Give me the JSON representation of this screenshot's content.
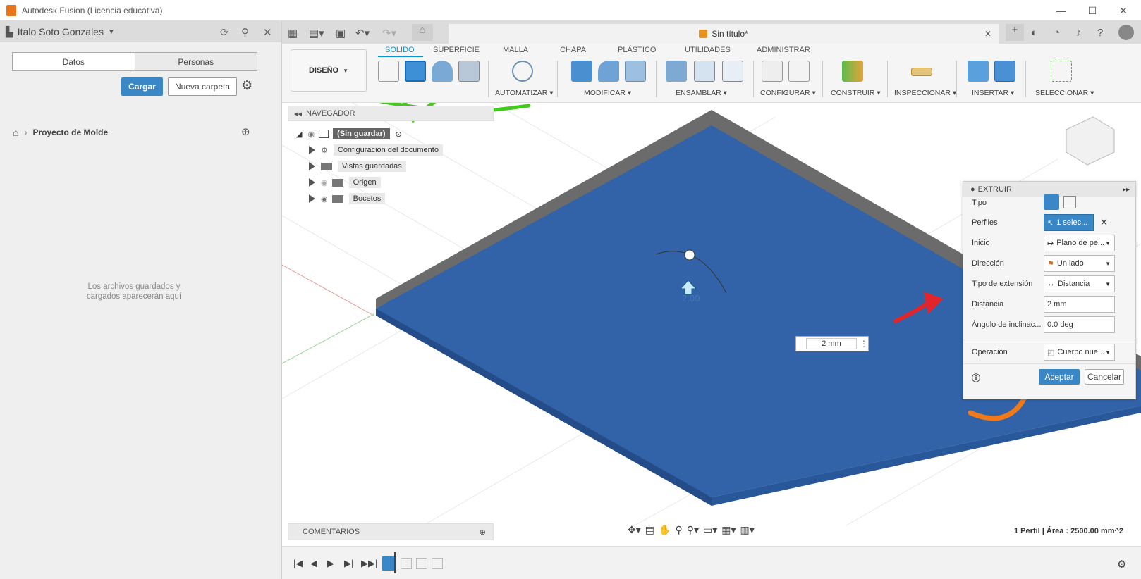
{
  "window": {
    "title": "Autodesk Fusion (Licencia educativa)"
  },
  "left_panel": {
    "user": "Italo Soto Gonzales",
    "tabs": [
      "Datos",
      "Personas"
    ],
    "upload_label": "Cargar",
    "new_folder_label": "Nueva carpeta",
    "breadcrumb": "Proyecto de Molde",
    "empty_message_1": "Los archivos guardados y",
    "empty_message_2": "cargados aparecerán aquí"
  },
  "document": {
    "tab_title": "Sin título*"
  },
  "ribbon": {
    "workspace": "DISEÑO",
    "tabs": [
      "SOLIDO",
      "SUPERFICIE",
      "MALLA",
      "CHAPA",
      "PLÁSTICO",
      "UTILIDADES",
      "ADMINISTRAR"
    ],
    "groups": [
      "AUTOMATIZAR ▾",
      "MODIFICAR ▾",
      "ENSAMBLAR ▾",
      "CONFIGURAR ▾",
      "CONSTRUIR ▾",
      "INSPECCIONAR ▾",
      "INSERTAR ▾",
      "SELECCIONAR ▾"
    ]
  },
  "navigator": {
    "title": "NAVEGADOR",
    "root": "(Sin guardar)",
    "items": [
      "Configuración del documento",
      "Vistas guardadas",
      "Origen",
      "Bocetos"
    ]
  },
  "extrude": {
    "title": "EXTRUIR",
    "labels": {
      "tipo": "Tipo",
      "perfiles": "Perfiles",
      "inicio": "Inicio",
      "direccion": "Dirección",
      "tipo_extension": "Tipo de extensión",
      "distancia": "Distancia",
      "angulo": "Ángulo de inclinac...",
      "operacion": "Operación"
    },
    "values": {
      "perfiles": "1 selec...",
      "inicio": "Plano de pe...",
      "direccion": "Un lado",
      "tipo_extension": "Distancia",
      "distancia": "2 mm",
      "angulo": "0.0 deg",
      "operacion": "Cuerpo nue..."
    },
    "ok_label": "Aceptar",
    "cancel_label": "Cancelar"
  },
  "viewport": {
    "distance_input": "2 mm",
    "dim_text": "2.00"
  },
  "comments": "COMENTARIOS",
  "status": "1 Perfil | Área : 2500.00 mm^2",
  "colors": {
    "accent": "#0696d7",
    "body": "#2f5fa8",
    "annotation_green": "#46c91f",
    "annotation_red": "#e0262a",
    "annotation_orange": "#f07a1a"
  }
}
